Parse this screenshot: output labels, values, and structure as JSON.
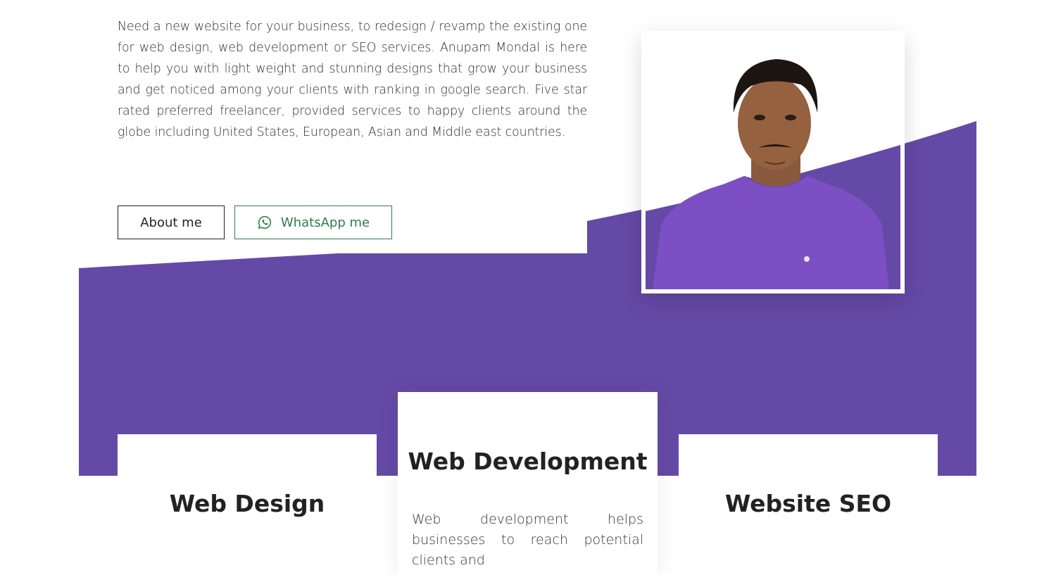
{
  "intro": {
    "text": "Need a new website for your business, to redesign / revamp the existing one for web design, web development or SEO services. Anupam Mondal is here to help you with light weight and stunning designs that grow your business and get noticed among your clients with ranking in google search. Five star rated preferred freelancer, provided services to happy clients around the globe including United States, European, Asian and Middle east countries."
  },
  "buttons": {
    "about_label": "About me",
    "whatsapp_label": "WhatsApp me"
  },
  "colors": {
    "accent_purple": "#6549a6",
    "whatsapp_green": "#2e7d4f",
    "shirt_purple": "#7c4fc4"
  },
  "services": {
    "web_design": {
      "title": "Web Design"
    },
    "web_development": {
      "title": "Web Development",
      "text": "Web development helps businesses to reach potential clients and"
    },
    "website_seo": {
      "title": "Website SEO"
    }
  },
  "icons": {
    "whatsapp": "whatsapp-icon",
    "profile_photo": "profile-photo"
  }
}
